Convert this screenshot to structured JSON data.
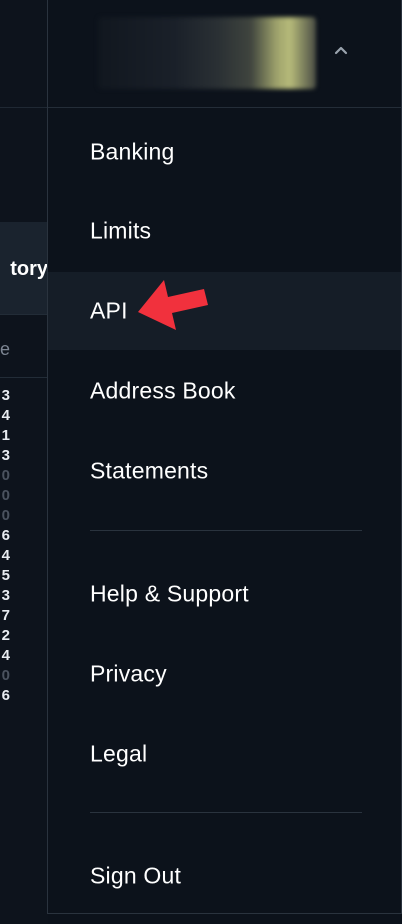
{
  "background": {
    "card_title": "tory",
    "subhead": "e",
    "digits": [
      "3",
      "4",
      "1",
      "3",
      "0",
      "0",
      "0",
      "6",
      "4",
      "5",
      "3",
      "7",
      "2",
      "4",
      "0",
      "6"
    ],
    "dim_digits": [
      4,
      5,
      6,
      14
    ]
  },
  "menu": {
    "account_toggle_icon": "chevron-up-icon",
    "items": [
      {
        "label": "Banking"
      },
      {
        "label": "Limits"
      },
      {
        "label": "API"
      },
      {
        "label": "Address Book"
      },
      {
        "label": "Statements"
      },
      {
        "label": "Help & Support"
      },
      {
        "label": "Privacy"
      },
      {
        "label": "Legal"
      },
      {
        "label": "Sign Out"
      }
    ],
    "active_index": 2
  },
  "annotation": {
    "icon": "red-arrow-icon",
    "color": "#f1313d"
  },
  "colors": {
    "background": "#0c121b",
    "active_row": "#151d27",
    "text": "#ffffff",
    "divider": "#2a333e"
  }
}
